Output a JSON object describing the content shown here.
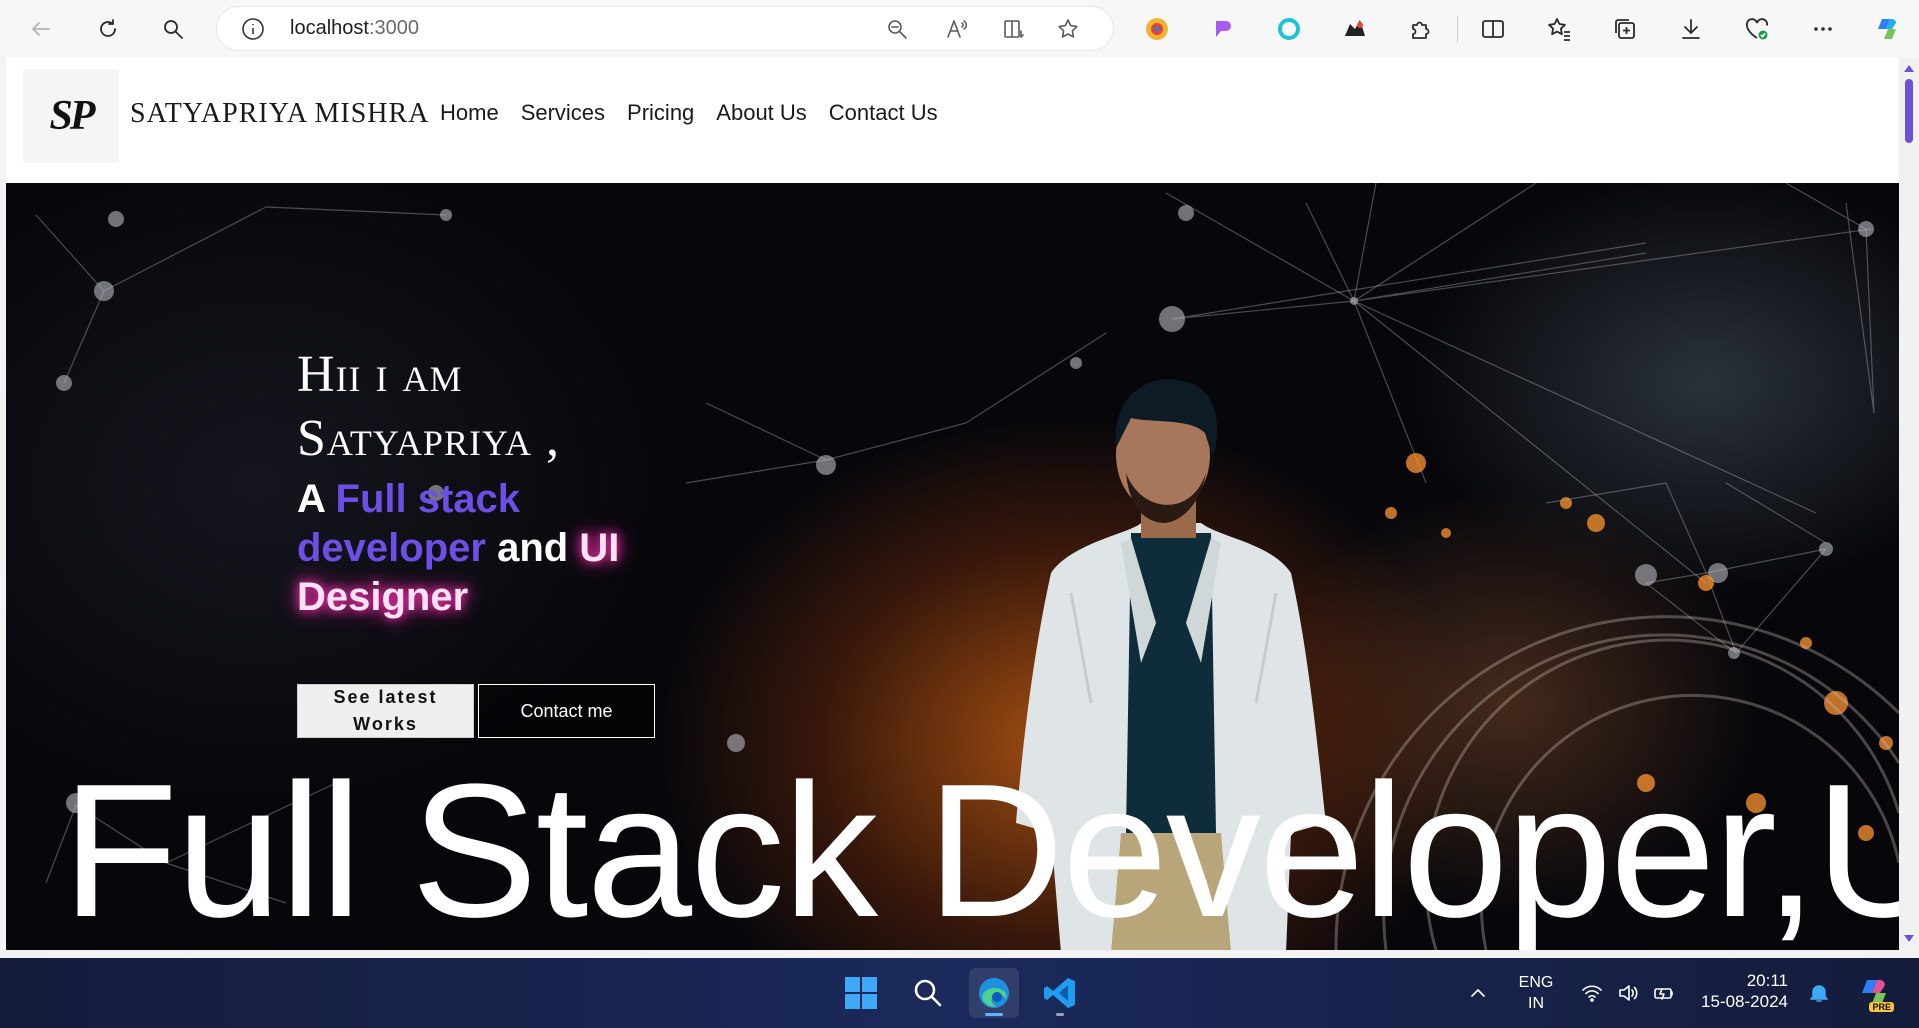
{
  "browser": {
    "url_host": "localhost",
    "url_port": ":3000"
  },
  "site": {
    "logo_text": "SP",
    "name": "SATYAPRIYA MISHRA",
    "nav": [
      "Home",
      "Services",
      "Pricing",
      "About Us",
      "Contact Us"
    ]
  },
  "hero": {
    "title_line1": "Hii i am",
    "title_line2": "Satyapriya ,",
    "sub_a": "A ",
    "sub_full_stack": "Full stack developer",
    "sub_and": " and ",
    "sub_ui_designer": "UI Designer",
    "btn_works": "See latest Works",
    "btn_contact": "Contact me",
    "marquee": "Full Stack Developer,UI"
  },
  "taskbar": {
    "lang_line1": "ENG",
    "lang_line2": "IN",
    "time": "20:11",
    "date": "15-08-2024",
    "copilot_badge": "PRE"
  },
  "colors": {
    "accent_purple": "#6d4fe6",
    "glow_pink": "#ff2fb0",
    "taskbar": "#1b2a5c"
  }
}
